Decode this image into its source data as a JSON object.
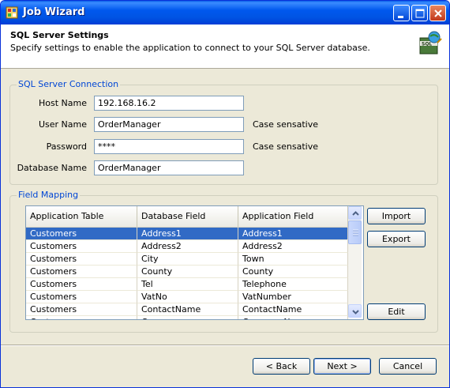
{
  "window": {
    "title": "Job Wizard"
  },
  "header": {
    "title": "SQL Server Settings",
    "subtitle": "Specify settings to enable the application to connect to your SQL Server database.",
    "icon": "sql-server-icon"
  },
  "connection": {
    "group_title": "SQL Server Connection",
    "host_label": "Host Name",
    "host_value": "192.168.16.2",
    "user_label": "User Name",
    "user_value": "OrderManager",
    "user_note": "Case sensative",
    "password_label": "Password",
    "password_value": "****",
    "password_note": "Case sensative",
    "database_label": "Database Name",
    "database_value": "OrderManager"
  },
  "mapping": {
    "group_title": "Field Mapping",
    "columns": [
      "Application Table",
      "Database Field",
      "Application Field"
    ],
    "rows": [
      [
        "Customers",
        "Address1",
        "Address1"
      ],
      [
        "Customers",
        "Address2",
        "Address2"
      ],
      [
        "Customers",
        "City",
        "Town"
      ],
      [
        "Customers",
        "County",
        "County"
      ],
      [
        "Customers",
        "Tel",
        "Telephone"
      ],
      [
        "Customers",
        "VatNo",
        "VatNumber"
      ],
      [
        "Customers",
        "ContactName",
        "ContactName"
      ],
      [
        "Customers",
        "Company",
        "CompanyName"
      ]
    ],
    "selected_row": 0,
    "import_label": "Import",
    "export_label": "Export",
    "edit_label": "Edit"
  },
  "footer": {
    "back_label": "< Back",
    "next_label": "Next >",
    "cancel_label": "Cancel"
  },
  "colors": {
    "titlebar": "#0054e3",
    "selection": "#316ac5",
    "group_title": "#0046d5",
    "dialog_bg": "#ece9d8"
  }
}
